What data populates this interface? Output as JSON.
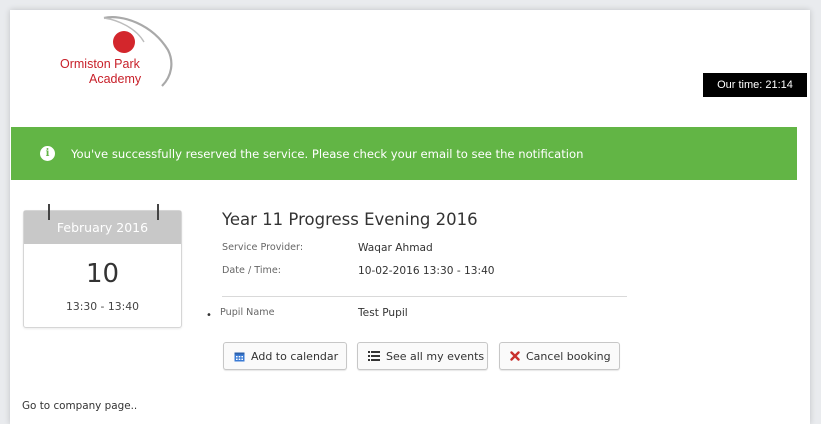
{
  "header": {
    "logo_line1": "Ormiston Park",
    "logo_line2": "Academy",
    "our_time": "Our time: 21:14"
  },
  "alert": {
    "message": "You've successfully reserved the service. Please check your email to see the notification",
    "color": "#62b545"
  },
  "calendar": {
    "month_year": "February 2016",
    "day": "10",
    "time_range": "13:30 - 13:40"
  },
  "event": {
    "title": "Year 11 Progress Evening 2016",
    "provider_label": "Service Provider:",
    "provider_value": "Waqar Ahmad",
    "datetime_label": "Date / Time:",
    "datetime_value": "10-02-2016  13:30 - 13:40",
    "pupil_label": "Pupil Name",
    "pupil_value": "Test Pupil"
  },
  "actions": {
    "add_calendar": "Add to calendar",
    "see_events": "See all my events",
    "cancel_booking": "Cancel booking"
  },
  "icons": {
    "alert": "info-icon",
    "add_calendar": "calendar-icon",
    "see_events": "list-icon",
    "cancel_booking": "x-icon"
  },
  "footer": {
    "company_link": "Go to company page.."
  }
}
